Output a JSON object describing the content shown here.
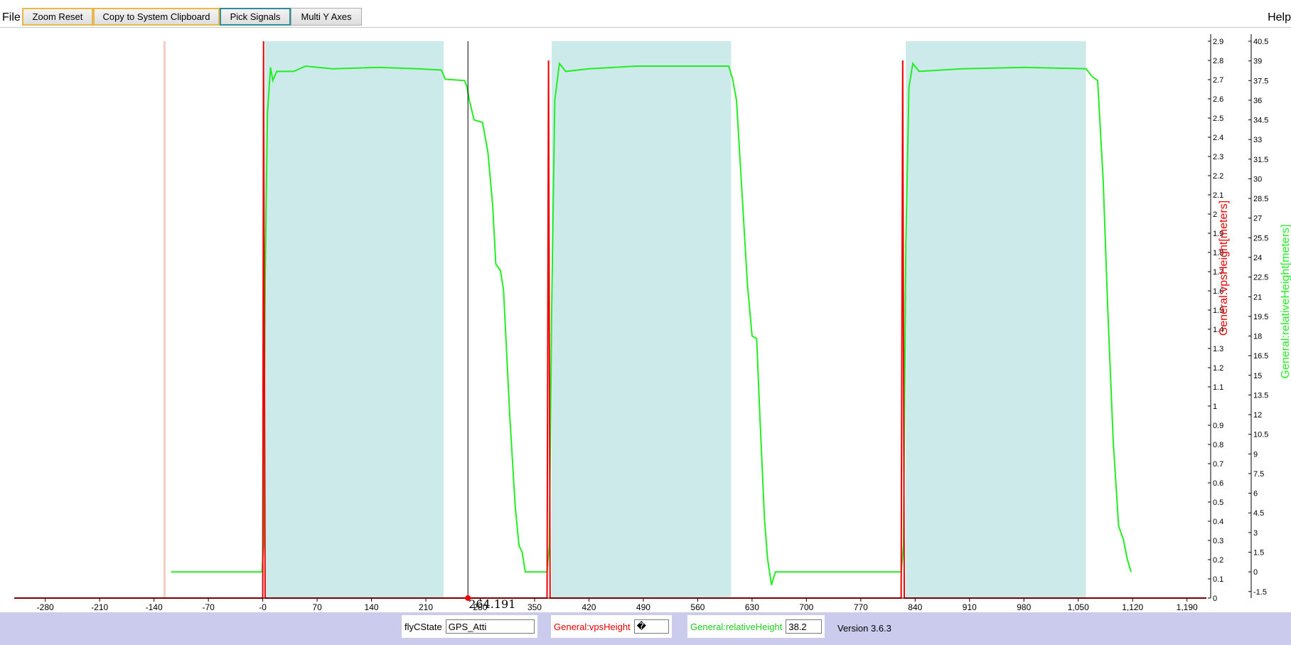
{
  "menu": {
    "file": "File",
    "help": "Help"
  },
  "toolbar": {
    "zoom_reset": "Zoom Reset",
    "copy_clipboard": "Copy to System Clipboard",
    "pick_signals": "Pick Signals",
    "multi_y_axes": "Multi Y Axes"
  },
  "cursor": {
    "readout": "264.191"
  },
  "status": {
    "flyc_label": "flyCState",
    "flyc_value": "GPS_Atti",
    "vps_label": "General:vpsHeight",
    "vps_value": "�",
    "rel_label": "General:relativeHeight",
    "rel_value": "38.2",
    "version": "Version 3.6.3"
  },
  "colors": {
    "vps_series": "#ee0000",
    "rel_series": "#22ee22",
    "shade_region": "#cdeaea",
    "status_bar": "#cbcbee",
    "cursor_marker": "#ee0000"
  },
  "chart_data": {
    "type": "line",
    "x_ticks": [
      "-280",
      "-210",
      "-140",
      "-70",
      "-0",
      "70",
      "140",
      "210",
      "280",
      "350",
      "420",
      "490",
      "560",
      "630",
      "700",
      "770",
      "840",
      "910",
      "980",
      "1,050",
      "1,120",
      "1,190"
    ],
    "xlim": [
      -320,
      1215
    ],
    "left_axis": {
      "label": "General:vpsHeight[meters]",
      "ylim": [
        0,
        2.9
      ],
      "ticks": [
        "0",
        "0.1",
        "0.2",
        "0.3",
        "0.4",
        "0.5",
        "0.6",
        "0.7",
        "0.8",
        "0.9",
        "1",
        "1.1",
        "1.2",
        "1.3",
        "1.4",
        "1.5",
        "1.6",
        "1.7",
        "1.8",
        "1.9",
        "2",
        "2.1",
        "2.2",
        "2.3",
        "2.4",
        "2.5",
        "2.6",
        "2.7",
        "2.8",
        "2.9"
      ]
    },
    "right_axis": {
      "label": "General:relativeHeight[meters]",
      "ylim": [
        -2,
        40.5
      ],
      "ticks": [
        "-1.5",
        "0",
        "1.5",
        "3",
        "4.5",
        "6",
        "7.5",
        "9",
        "10.5",
        "12",
        "13.5",
        "15",
        "16.5",
        "18",
        "19.5",
        "21",
        "22.5",
        "24",
        "25.5",
        "27",
        "28.5",
        "30",
        "31.5",
        "33",
        "34.5",
        "36",
        "37.5",
        "39",
        "40.5"
      ]
    },
    "shaded_regions": [
      [
        3,
        233
      ],
      [
        372,
        603
      ],
      [
        828,
        1060
      ]
    ],
    "markers": [
      [
        -128,
        -125
      ]
    ],
    "cursor_x": 264.191,
    "series": [
      {
        "name": "General:relativeHeight",
        "axis": "right",
        "points": [
          [
            -118,
            0
          ],
          [
            -1,
            0
          ],
          [
            1,
            2
          ],
          [
            3,
            22
          ],
          [
            6,
            35
          ],
          [
            10,
            38.5
          ],
          [
            13,
            37.5
          ],
          [
            18,
            38.2
          ],
          [
            40,
            38.2
          ],
          [
            55,
            38.6
          ],
          [
            90,
            38.4
          ],
          [
            150,
            38.5
          ],
          [
            200,
            38.4
          ],
          [
            230,
            38.3
          ],
          [
            235,
            37.6
          ],
          [
            260,
            37.5
          ],
          [
            263,
            37.0
          ],
          [
            266,
            36.0
          ],
          [
            272,
            34.5
          ],
          [
            283,
            34.3
          ],
          [
            290,
            32.0
          ],
          [
            296,
            28.0
          ],
          [
            300,
            23.5
          ],
          [
            306,
            23.0
          ],
          [
            310,
            21.5
          ],
          [
            318,
            12.0
          ],
          [
            325,
            5.0
          ],
          [
            330,
            2.0
          ],
          [
            334,
            1.5
          ],
          [
            338,
            0
          ],
          [
            366,
            0
          ],
          [
            369,
            2
          ],
          [
            372,
            20
          ],
          [
            376,
            36
          ],
          [
            382,
            38.8
          ],
          [
            390,
            38.2
          ],
          [
            420,
            38.4
          ],
          [
            480,
            38.6
          ],
          [
            600,
            38.6
          ],
          [
            605,
            37.6
          ],
          [
            610,
            36.0
          ],
          [
            616,
            30.0
          ],
          [
            624,
            22.0
          ],
          [
            630,
            18.0
          ],
          [
            636,
            17.8
          ],
          [
            640,
            12.0
          ],
          [
            646,
            4.0
          ],
          [
            650,
            1.0
          ],
          [
            655,
            -1.0
          ],
          [
            660,
            0
          ],
          [
            822,
            0
          ],
          [
            825,
            2
          ],
          [
            828,
            25
          ],
          [
            832,
            37
          ],
          [
            837,
            38.8
          ],
          [
            845,
            38.2
          ],
          [
            900,
            38.4
          ],
          [
            980,
            38.5
          ],
          [
            1060,
            38.4
          ],
          [
            1068,
            37.8
          ],
          [
            1075,
            37.5
          ],
          [
            1082,
            30.0
          ],
          [
            1088,
            20.0
          ],
          [
            1095,
            10.0
          ],
          [
            1102,
            3.5
          ],
          [
            1108,
            2.5
          ],
          [
            1113,
            1.0
          ],
          [
            1118,
            0
          ]
        ]
      },
      {
        "name": "General:vpsHeight",
        "axis": "left",
        "points": [
          [
            -320,
            0
          ],
          [
            0,
            0
          ],
          [
            1,
            2.9
          ],
          [
            3,
            0
          ],
          [
            338,
            0
          ],
          [
            366,
            0
          ],
          [
            368,
            2.8
          ],
          [
            370,
            0
          ],
          [
            605,
            0
          ],
          [
            660,
            0
          ],
          [
            822,
            0
          ],
          [
            824,
            2.8
          ],
          [
            826,
            0
          ],
          [
            1215,
            0
          ]
        ]
      }
    ]
  }
}
